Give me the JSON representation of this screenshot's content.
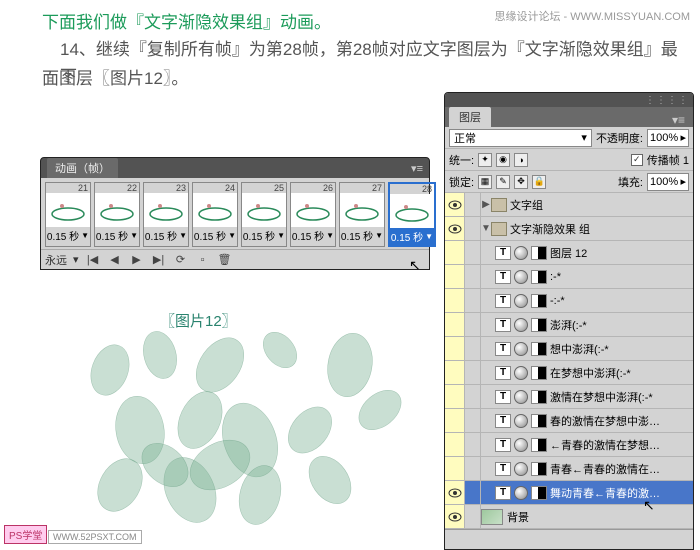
{
  "header": {
    "site": "思缘设计论坛 - WWW.MISSYUAN.COM"
  },
  "text": {
    "line1": "下面我们做『文字渐隐效果组』动画。",
    "line2": "14、继续『复制所有帧』为第28帧，第28帧对应文字图层为『文字渐隐效果组』最下",
    "line3": "面图层〖图片12〗。",
    "img12": "〖图片12〗"
  },
  "anim": {
    "title": "动画（帧）",
    "frames": [
      {
        "n": "21",
        "d": "0.15 秒"
      },
      {
        "n": "22",
        "d": "0.15 秒"
      },
      {
        "n": "23",
        "d": "0.15 秒"
      },
      {
        "n": "24",
        "d": "0.15 秒"
      },
      {
        "n": "25",
        "d": "0.15 秒"
      },
      {
        "n": "26",
        "d": "0.15 秒"
      },
      {
        "n": "27",
        "d": "0.15 秒"
      },
      {
        "n": "28",
        "d": "0.15 秒"
      }
    ],
    "loop": "永远"
  },
  "layers": {
    "tab": "图层",
    "blend": "正常",
    "opacity_label": "不透明度:",
    "opacity": "100%",
    "unify": "统一:",
    "propagate": "传播帧 1",
    "lock": "锁定:",
    "fill_label": "填充:",
    "fill": "100%",
    "items": [
      {
        "eye": true,
        "type": "folder",
        "name": "文字组",
        "indent": 0,
        "twisty": "▶"
      },
      {
        "eye": true,
        "type": "folder",
        "name": "文字渐隐效果 组",
        "indent": 0,
        "twisty": "▼"
      },
      {
        "eye": false,
        "type": "T",
        "name": "图层 12",
        "indent": 1
      },
      {
        "eye": false,
        "type": "T",
        "name": ":-*",
        "indent": 1
      },
      {
        "eye": false,
        "type": "T",
        "name": "-:-*",
        "indent": 1
      },
      {
        "eye": false,
        "type": "T",
        "name": "澎湃(:-*",
        "indent": 1
      },
      {
        "eye": false,
        "type": "T",
        "name": "想中澎湃(:-*",
        "indent": 1
      },
      {
        "eye": false,
        "type": "T",
        "name": "在梦想中澎湃(:-*",
        "indent": 1
      },
      {
        "eye": false,
        "type": "T",
        "name": "激情在梦想中澎湃(:-*",
        "indent": 1
      },
      {
        "eye": false,
        "type": "T",
        "name": "春的激情在梦想中澎…",
        "indent": 1
      },
      {
        "eye": false,
        "type": "T",
        "name": "←青春的激情在梦想…",
        "indent": 1
      },
      {
        "eye": false,
        "type": "T",
        "name": "青春←青春的激情在…",
        "indent": 1
      },
      {
        "eye": true,
        "type": "T",
        "name": "舞动青春←青春的激…",
        "indent": 1,
        "sel": true
      },
      {
        "eye": true,
        "type": "bg",
        "name": "背景",
        "indent": 0
      }
    ]
  },
  "watermark": {
    "a": "PS学堂",
    "b": "WWW.52PSXT.COM"
  }
}
